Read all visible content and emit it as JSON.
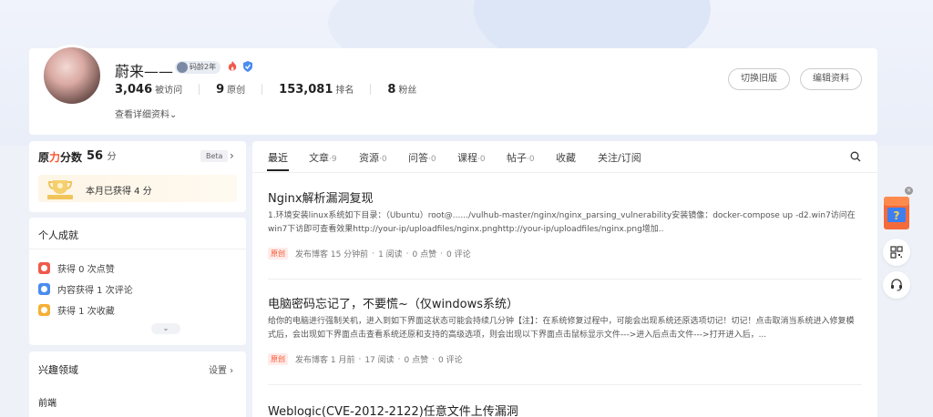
{
  "profile": {
    "name": "蔚来——",
    "level_badge": "码龄2年",
    "stats": [
      {
        "value": "3,046",
        "label": "被访问"
      },
      {
        "value": "9",
        "label": "原创"
      },
      {
        "value": "153,081",
        "label": "排名"
      },
      {
        "value": "8",
        "label": "粉丝"
      }
    ],
    "detail_link": "查看详细资料",
    "btn_old_version": "切换旧版",
    "btn_edit_profile": "编辑资料"
  },
  "power": {
    "title_prefix": "原",
    "title_highlight": "力",
    "title_suffix": "分数",
    "score": "56",
    "unit": "分",
    "beta": "Beta",
    "monthly_text": "本月已获得 4 分"
  },
  "achievements": {
    "title": "个人成就",
    "items": [
      {
        "text": "获得 0 次点赞",
        "color": "#f05a4a"
      },
      {
        "text": "内容获得 1 次评论",
        "color": "#4a8cf0"
      },
      {
        "text": "获得 1 次收藏",
        "color": "#f5b035"
      }
    ]
  },
  "interests": {
    "title": "兴趣领域",
    "settings": "设置",
    "items": [
      "前端"
    ]
  },
  "tabs": [
    {
      "label": "最近",
      "count": ""
    },
    {
      "label": "文章",
      "count": "·9"
    },
    {
      "label": "资源",
      "count": "·0"
    },
    {
      "label": "问答",
      "count": "·0"
    },
    {
      "label": "课程",
      "count": "·0"
    },
    {
      "label": "帖子",
      "count": "·0"
    },
    {
      "label": "收藏",
      "count": ""
    },
    {
      "label": "关注/订阅",
      "count": ""
    }
  ],
  "articles": [
    {
      "title": "Nginx解析漏洞复现",
      "desc": "1.环境安装linux系统如下目录：（Ubuntu）root@....../vulhub-master/nginx/nginx_parsing_vulnerability安装镜像：docker-compose up -d2.win7访问在win7下访即可查看效果http://your-ip/uploadfiles/nginx.pnghttp://your-ip/uploadfiles/nginx.png增加..",
      "tag": "原创",
      "published": "发布博客 15 分钟前",
      "reads": "1 阅读",
      "likes": "0 点赞",
      "comments": "0 评论"
    },
    {
      "title": "电脑密码忘记了，不要慌~（仅windows系统）",
      "desc": "给你的电脑进行强制关机，进入到如下界面这状态可能会持续几分钟【注】：在系统修复过程中，可能会出现系统还原选项切记！切记！点击取消当系统进入修复模式后，会出现如下界面点击查看系统还原和支持的高级选项，则会出现以下界面点击鼠标显示文件--->进入后点击文件--->打开进入后，...",
      "tag": "原创",
      "published": "发布博客 1 月前",
      "reads": "17 阅读",
      "likes": "0 点赞",
      "comments": "0 评论"
    },
    {
      "title": "Weblogic(CVE-2012-2122)任意文件上传漏洞"
    }
  ],
  "sep": "·"
}
